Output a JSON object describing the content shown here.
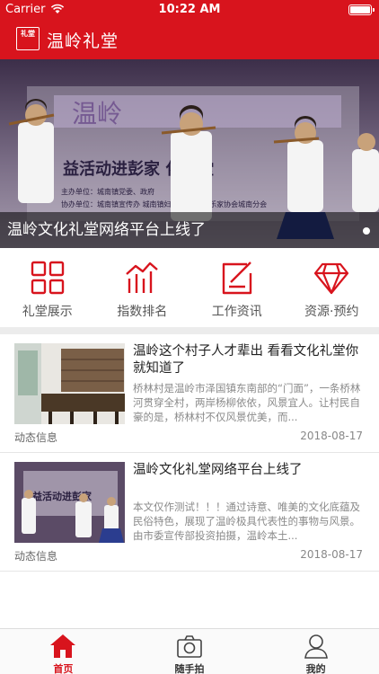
{
  "status_bar": {
    "carrier": "Carrier",
    "time": "10:22 AM"
  },
  "header": {
    "logo_text": "礼堂",
    "title": "温岭礼堂"
  },
  "banner": {
    "caption": "温岭文化礼堂网络平台上线了",
    "stage_text": "益活动进彭家 化礼堂",
    "sponsor_line_1": "主办单位：城南镇党委、政府",
    "sponsor_line_2": "协办单位：城南镇宣传办 城南镇妇联 温岭市音乐家协会城南分会"
  },
  "categories": [
    {
      "label": "礼堂展示",
      "icon": "grid-icon"
    },
    {
      "label": "指数排名",
      "icon": "chart-icon"
    },
    {
      "label": "工作资讯",
      "icon": "edit-icon"
    },
    {
      "label": "资源·预约",
      "icon": "diamond-icon"
    }
  ],
  "news": [
    {
      "title": "温岭这个村子人才辈出 看看文化礼堂你就知道了",
      "summary": "桥林村是温岭市泽国镇东南部的“门面”，一条桥林河贯穿全村，两岸杨柳依依，风景宜人。让村民自豪的是，桥林村不仅风景优美，而...",
      "tag": "动态信息",
      "date": "2018-08-17"
    },
    {
      "title": "温岭文化礼堂网络平台上线了",
      "summary": "本文仅作测试！！！通过诗意、唯美的文化底蕴及民俗特色，展现了温岭极具代表性的事物与风景。由市委宣传部投资拍摄，温岭本土...",
      "tag": "动态信息",
      "date": "2018-08-17"
    }
  ],
  "tabbar": [
    {
      "label": "首页",
      "icon": "home-icon",
      "active": true
    },
    {
      "label": "随手拍",
      "icon": "camera-icon",
      "active": false
    },
    {
      "label": "我的",
      "icon": "user-icon",
      "active": false
    }
  ],
  "colors": {
    "brand_red": "#d8141d",
    "tab_active": "#d8141d",
    "tab_inactive": "#333333"
  }
}
